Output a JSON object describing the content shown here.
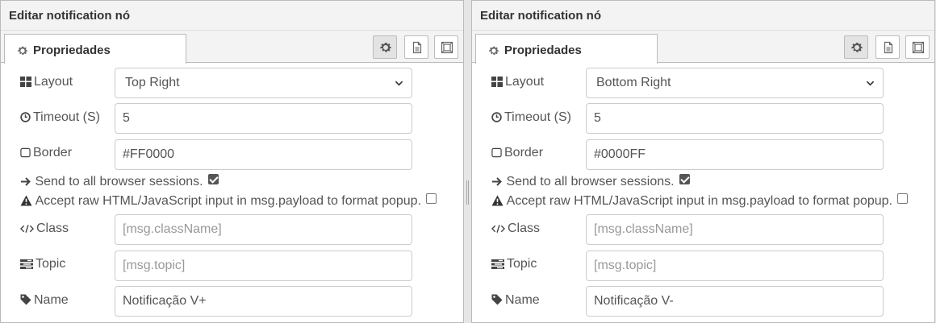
{
  "panels": [
    {
      "title": "Editar notification nó",
      "tab_label": "Propriedades",
      "layout": {
        "label": "Layout",
        "value": "Top Right"
      },
      "timeout": {
        "label": "Timeout (S)",
        "value": "5"
      },
      "border": {
        "label": "Border",
        "value": "#FF0000"
      },
      "send_all": {
        "label": "Send to all browser sessions.",
        "checked": true
      },
      "raw_html": {
        "label": "Accept raw HTML/JavaScript input in msg.payload to format popup.",
        "checked": false
      },
      "class_field": {
        "label": "Class",
        "placeholder": "[msg.className]"
      },
      "topic": {
        "label": "Topic",
        "placeholder": "[msg.topic]"
      },
      "name": {
        "label": "Name",
        "value": "Notificação V+"
      }
    },
    {
      "title": "Editar notification nó",
      "tab_label": "Propriedades",
      "layout": {
        "label": "Layout",
        "value": "Bottom Right"
      },
      "timeout": {
        "label": "Timeout (S)",
        "value": "5"
      },
      "border": {
        "label": "Border",
        "value": "#0000FF"
      },
      "send_all": {
        "label": "Send to all browser sessions.",
        "checked": true
      },
      "raw_html": {
        "label": "Accept raw HTML/JavaScript input in msg.payload to format popup.",
        "checked": false
      },
      "class_field": {
        "label": "Class",
        "placeholder": "[msg.className]"
      },
      "topic": {
        "label": "Topic",
        "placeholder": "[msg.topic]"
      },
      "name": {
        "label": "Name",
        "value": "Notificação V-"
      }
    }
  ],
  "icons": [
    "gear-icon",
    "file-icon",
    "window-icon",
    "th-large-icon",
    "clock-icon",
    "square-icon",
    "arrow-right-icon",
    "warning-icon",
    "code-icon",
    "tasks-icon",
    "tag-icon",
    "chevron-down-icon"
  ],
  "colors": {
    "panel_bg": "#ffffff",
    "header_bg": "#f3f3f3",
    "border": "#bbbbbb",
    "text": "#555555",
    "placeholder": "#999999"
  }
}
